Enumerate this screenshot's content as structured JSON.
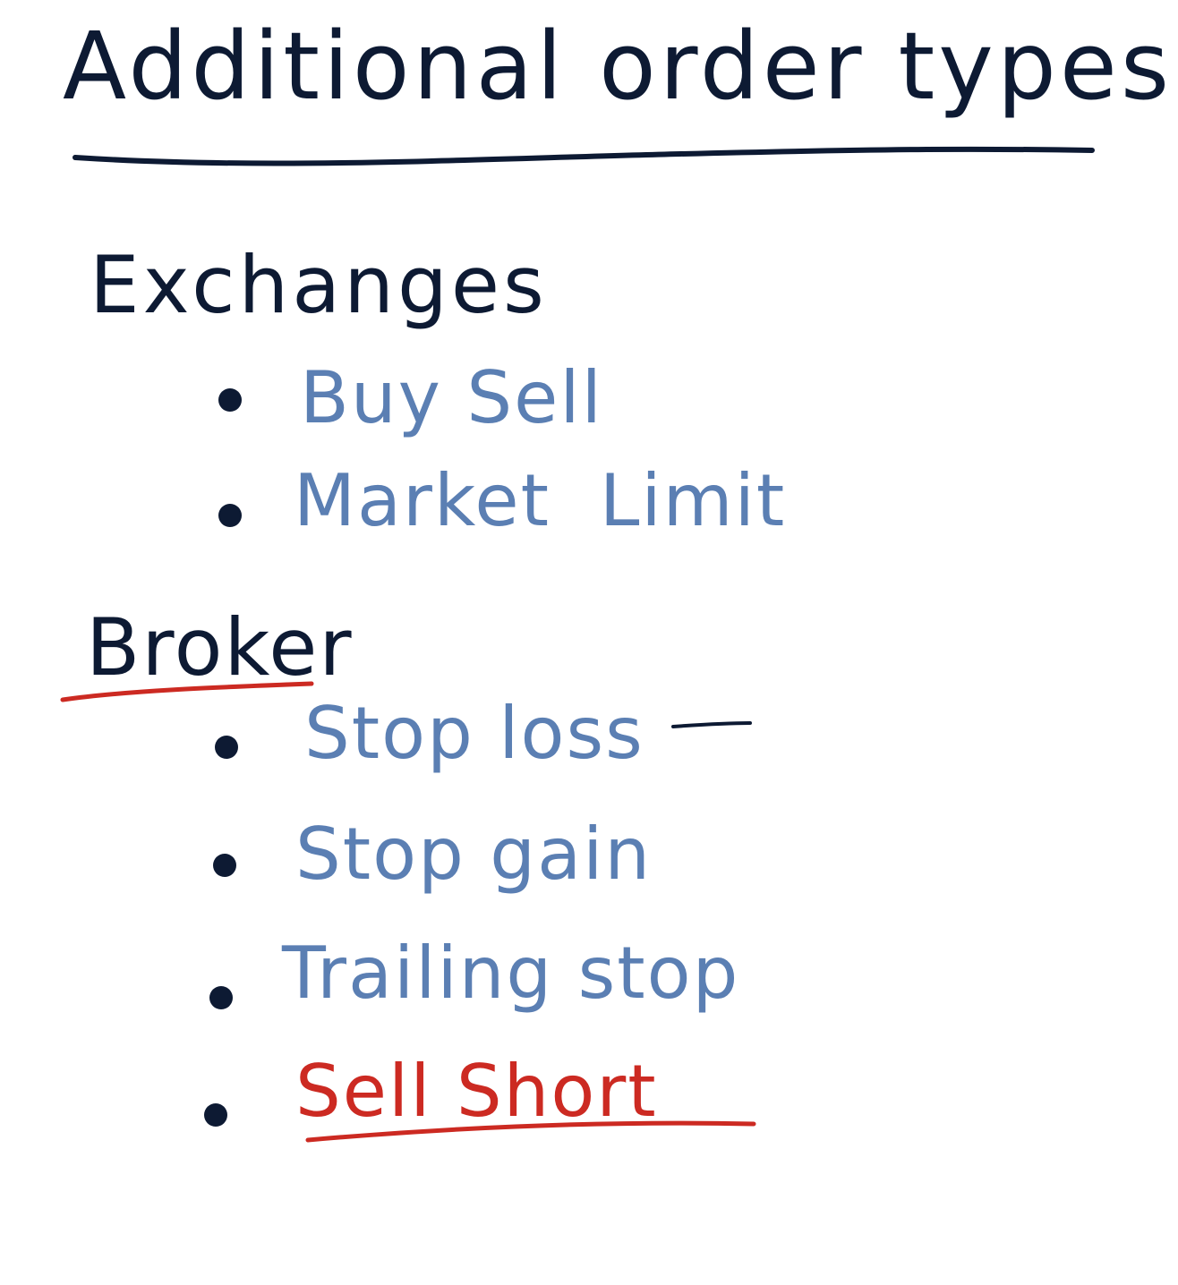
{
  "title": "Additional order types",
  "sections": [
    {
      "heading": "Exchanges",
      "items": [
        "Buy Sell",
        "Market  Limit"
      ]
    },
    {
      "heading": "Broker",
      "items": [
        "Stop loss",
        "Stop gain",
        "Trailing stop",
        "Sell Short"
      ]
    }
  ],
  "colors": {
    "ink": "#0d1a33",
    "blue": "#5b7fb3",
    "red": "#cc2a22"
  }
}
